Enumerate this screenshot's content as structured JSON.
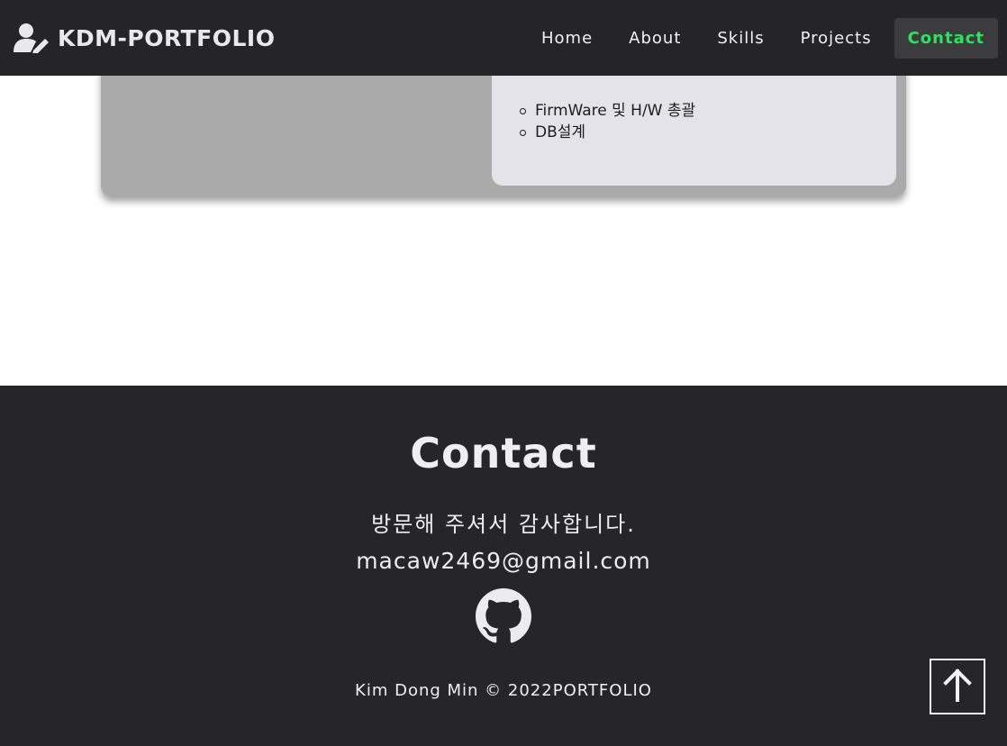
{
  "nav": {
    "brand_icon": "user-pen-icon",
    "brand": "KDM-PORTFOLIO",
    "items": [
      {
        "label": "Home"
      },
      {
        "label": "About"
      },
      {
        "label": "Skills"
      },
      {
        "label": "Projects"
      },
      {
        "label": "Contact",
        "active": true
      }
    ],
    "active_color": "#23e85a"
  },
  "project_card": {
    "details": [
      "FirmWare 및 H/W 총괄",
      "DB설계"
    ]
  },
  "footer": {
    "title": "Contact",
    "thanks": "방문해 주셔서 감사합니다.",
    "email": "macaw2469@gmail.com",
    "github_icon": "github-icon",
    "copyright": "Kim Dong Min © 2022PORTFOLIO"
  },
  "top_button": {
    "icon": "arrow-up-icon"
  },
  "colors": {
    "nav_bg": "#252527",
    "footer_bg": "#262628",
    "card_bg": "#aaaaab",
    "detail_bg": "#e4e3ea"
  }
}
